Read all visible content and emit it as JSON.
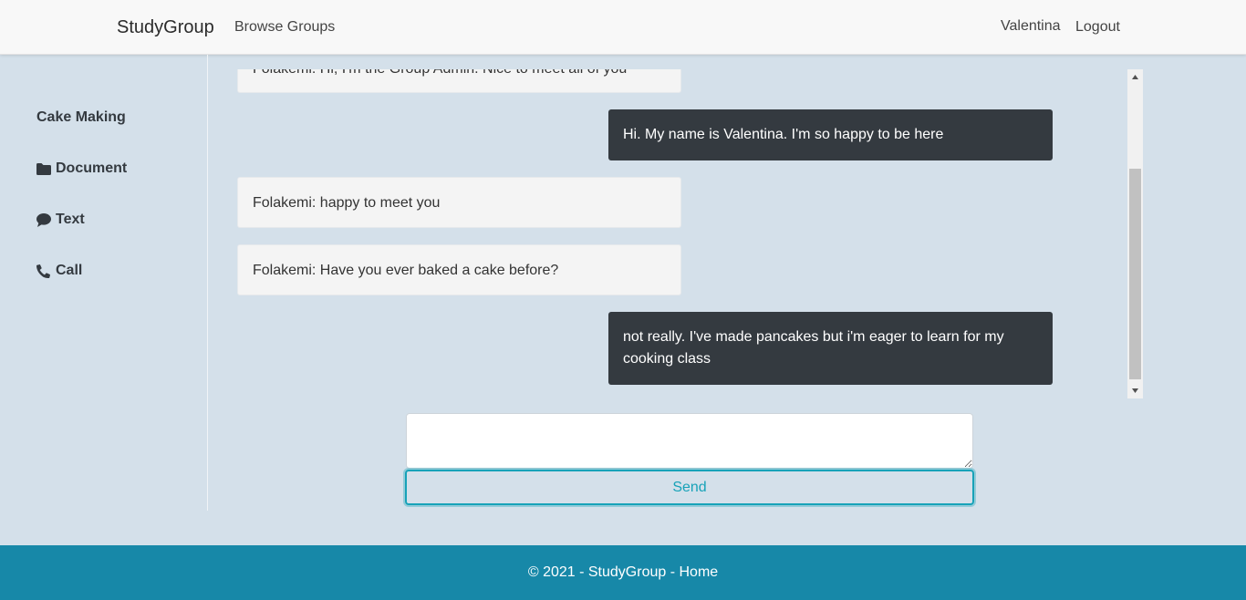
{
  "navbar": {
    "brand": "StudyGroup",
    "browse_groups": "Browse Groups",
    "username": "Valentina",
    "logout": "Logout"
  },
  "sidebar": {
    "group_name": "Cake Making",
    "items": [
      {
        "label": "Document",
        "icon": "folder-icon"
      },
      {
        "label": "Text",
        "icon": "comment-icon"
      },
      {
        "label": "Call",
        "icon": "phone-icon"
      }
    ]
  },
  "chat": {
    "messages": [
      {
        "direction": "incoming",
        "text": "Folakemi: Hi, I'm the Group Admin. Nice to meet all of you"
      },
      {
        "direction": "outgoing",
        "text": "Hi. My name is Valentina. I'm so happy to be here"
      },
      {
        "direction": "incoming",
        "text": "Folakemi: happy to meet you"
      },
      {
        "direction": "incoming",
        "text": "Folakemi: Have you ever baked a cake before?"
      },
      {
        "direction": "outgoing",
        "text": "not really. I've made pancakes but i'm eager to learn for my cooking class"
      }
    ]
  },
  "composer": {
    "value": "",
    "send_label": "Send"
  },
  "footer": {
    "copyright": "© 2021 - StudyGroup - ",
    "home_link": "Home"
  },
  "colors": {
    "page_bg": "#d4e0ea",
    "incoming_bg": "#f4f4f4",
    "outgoing_bg": "#343a40",
    "accent": "#17a2b8",
    "footer_bg": "#1788a8"
  }
}
